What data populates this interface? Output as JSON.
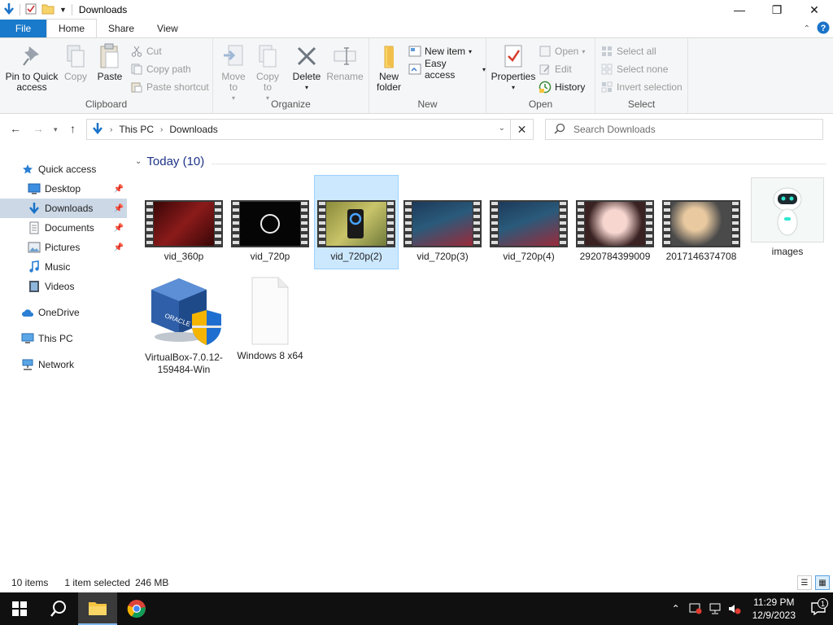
{
  "window": {
    "title": "Downloads",
    "controls": {
      "minimize": "—",
      "maximize": "❐",
      "close": "✕"
    }
  },
  "ribbon_tabs": [
    "File",
    "Home",
    "Share",
    "View"
  ],
  "ribbon": {
    "clipboard": {
      "label": "Clipboard",
      "pin": "Pin to Quick access",
      "copy": "Copy",
      "paste": "Paste",
      "cut": "Cut",
      "copy_path": "Copy path",
      "paste_shortcut": "Paste shortcut"
    },
    "organize": {
      "label": "Organize",
      "move_to": "Move to",
      "copy_to": "Copy to",
      "delete": "Delete",
      "rename": "Rename"
    },
    "new": {
      "label": "New",
      "new_folder": "New folder",
      "new_item": "New item",
      "easy_access": "Easy access"
    },
    "open": {
      "label": "Open",
      "properties": "Properties",
      "open": "Open",
      "edit": "Edit",
      "history": "History"
    },
    "select": {
      "label": "Select",
      "select_all": "Select all",
      "select_none": "Select none",
      "invert_selection": "Invert selection"
    }
  },
  "address": {
    "crumbs": [
      "This PC",
      "Downloads"
    ],
    "search_placeholder": "Search Downloads"
  },
  "nav": {
    "quick_access": "Quick access",
    "desktop": "Desktop",
    "downloads": "Downloads",
    "documents": "Documents",
    "pictures": "Pictures",
    "music": "Music",
    "videos": "Videos",
    "onedrive": "OneDrive",
    "this_pc": "This PC",
    "network": "Network"
  },
  "content": {
    "group_title": "Today (10)",
    "files": [
      {
        "name": "vid_360p"
      },
      {
        "name": "vid_720p"
      },
      {
        "name": "vid_720p(2)"
      },
      {
        "name": "vid_720p(3)"
      },
      {
        "name": "vid_720p(4)"
      },
      {
        "name": "2920784399009"
      },
      {
        "name": "2017146374708"
      },
      {
        "name": "images"
      },
      {
        "name": "VirtualBox-7.0.12-159484-Win"
      },
      {
        "name": "Windows 8 x64"
      }
    ]
  },
  "status": {
    "items": "10 items",
    "selected": "1 item selected",
    "size": "246 MB"
  },
  "taskbar": {
    "time": "11:29 PM",
    "date": "12/9/2023",
    "notification_count": "1"
  }
}
